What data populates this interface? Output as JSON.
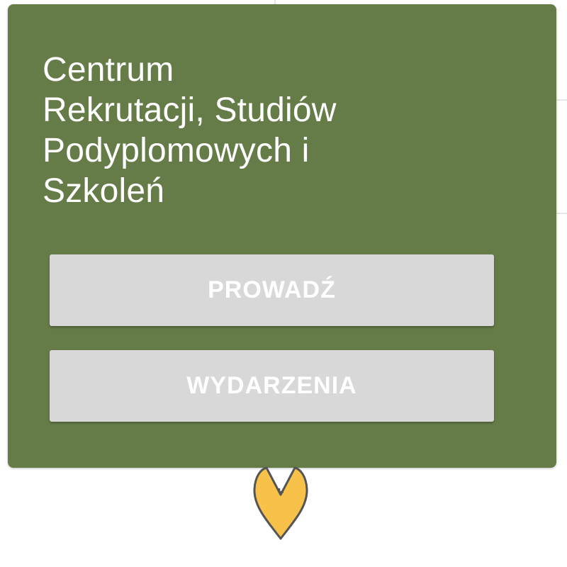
{
  "popup": {
    "title": "Centrum\nRekrutacji, Studiów\nPodyplomowych i\nSzkoleń",
    "background_color": "#667c48",
    "buttons": {
      "lead_label": "PROWADŹ",
      "events_label": "WYDARZENIA"
    }
  },
  "marker": {
    "icon": "map-pin-heart-icon",
    "fill_color": "#f8c14a",
    "stroke_color": "#555555"
  }
}
